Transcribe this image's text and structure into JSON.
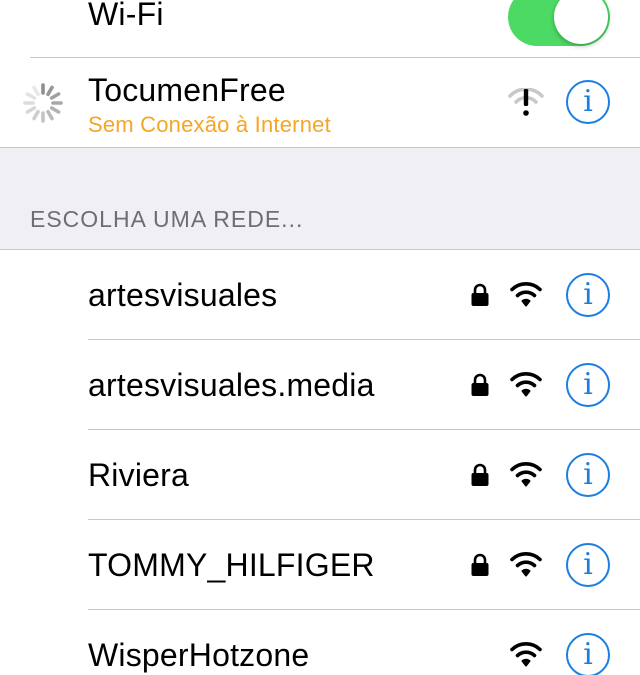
{
  "wifi": {
    "label": "Wi-Fi",
    "enabled": true,
    "toggle_color": "#4cd964"
  },
  "connected": {
    "name": "TocumenFree",
    "status": "Sem Conexão à Internet",
    "status_color": "#f5a623",
    "state_icon": "loading-spinner-icon",
    "signal_icon": "wifi-warning-icon",
    "info_glyph": "i"
  },
  "section": {
    "title": "ESCOLHA UMA REDE..."
  },
  "networks": [
    {
      "name": "artesvisuales",
      "secured": true,
      "info_glyph": "i"
    },
    {
      "name": "artesvisuales.media",
      "secured": true,
      "info_glyph": "i"
    },
    {
      "name": "Riviera",
      "secured": true,
      "info_glyph": "i"
    },
    {
      "name": "TOMMY_HILFIGER",
      "secured": true,
      "info_glyph": "i"
    },
    {
      "name": "WisperHotzone",
      "secured": false,
      "info_glyph": "i"
    }
  ],
  "colors": {
    "accent": "#1a7fe0",
    "group_background": "#efeff4",
    "separator": "#c8c7cc"
  }
}
